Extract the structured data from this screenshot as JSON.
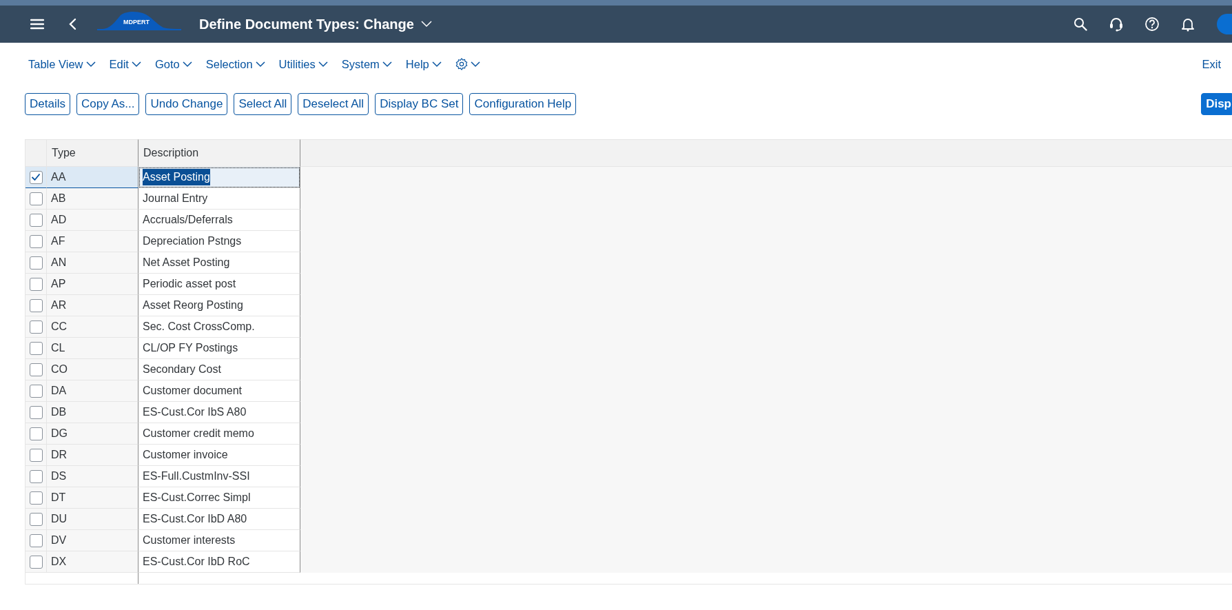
{
  "shell_bar": {
    "logo_text": "MDPERT",
    "title": "Define Document Types: Change"
  },
  "menu": [
    "Table View",
    "Edit",
    "Goto",
    "Selection",
    "Utilities",
    "System",
    "Help"
  ],
  "exit": "Exit",
  "toolbar": [
    {
      "label": "Details",
      "kind": "outline"
    },
    {
      "label": "Copy As...",
      "kind": "outline"
    },
    {
      "label": "Undo Change",
      "kind": "outline"
    },
    {
      "label": "Select All",
      "kind": "outline"
    },
    {
      "label": "Deselect All",
      "kind": "outline"
    },
    {
      "label": "Display BC Set",
      "kind": "outline"
    },
    {
      "label": "Configuration Help",
      "kind": "outline"
    },
    {
      "label": "Disp",
      "kind": "primary"
    }
  ],
  "table": {
    "columns": [
      "Type",
      "Description"
    ],
    "rows": [
      {
        "type": "AA",
        "description": "Asset Posting",
        "checked": true,
        "selected": true,
        "focused": true
      },
      {
        "type": "AB",
        "description": "Journal Entry",
        "checked": false,
        "selected": false,
        "focused": false
      },
      {
        "type": "AD",
        "description": "Accruals/Deferrals",
        "checked": false,
        "selected": false,
        "focused": false
      },
      {
        "type": "AF",
        "description": "Depreciation Pstngs",
        "checked": false,
        "selected": false,
        "focused": false
      },
      {
        "type": "AN",
        "description": "Net Asset Posting",
        "checked": false,
        "selected": false,
        "focused": false
      },
      {
        "type": "AP",
        "description": "Periodic asset post",
        "checked": false,
        "selected": false,
        "focused": false
      },
      {
        "type": "AR",
        "description": "Asset Reorg Posting",
        "checked": false,
        "selected": false,
        "focused": false
      },
      {
        "type": "CC",
        "description": "Sec. Cost CrossComp.",
        "checked": false,
        "selected": false,
        "focused": false
      },
      {
        "type": "CL",
        "description": "CL/OP FY Postings",
        "checked": false,
        "selected": false,
        "focused": false
      },
      {
        "type": "CO",
        "description": "Secondary Cost",
        "checked": false,
        "selected": false,
        "focused": false
      },
      {
        "type": "DA",
        "description": "Customer document",
        "checked": false,
        "selected": false,
        "focused": false
      },
      {
        "type": "DB",
        "description": "ES-Cust.Cor IbS A80",
        "checked": false,
        "selected": false,
        "focused": false
      },
      {
        "type": "DG",
        "description": "Customer credit memo",
        "checked": false,
        "selected": false,
        "focused": false
      },
      {
        "type": "DR",
        "description": "Customer invoice",
        "checked": false,
        "selected": false,
        "focused": false
      },
      {
        "type": "DS",
        "description": "ES-Full.CustmInv-SSI",
        "checked": false,
        "selected": false,
        "focused": false
      },
      {
        "type": "DT",
        "description": "ES-Cust.Correc Simpl",
        "checked": false,
        "selected": false,
        "focused": false
      },
      {
        "type": "DU",
        "description": "ES-Cust.Cor IbD A80",
        "checked": false,
        "selected": false,
        "focused": false
      },
      {
        "type": "DV",
        "description": "Customer interests",
        "checked": false,
        "selected": false,
        "focused": false
      },
      {
        "type": "DX",
        "description": "ES-Cust.Cor IbD RoC",
        "checked": false,
        "selected": false,
        "focused": false
      }
    ]
  }
}
